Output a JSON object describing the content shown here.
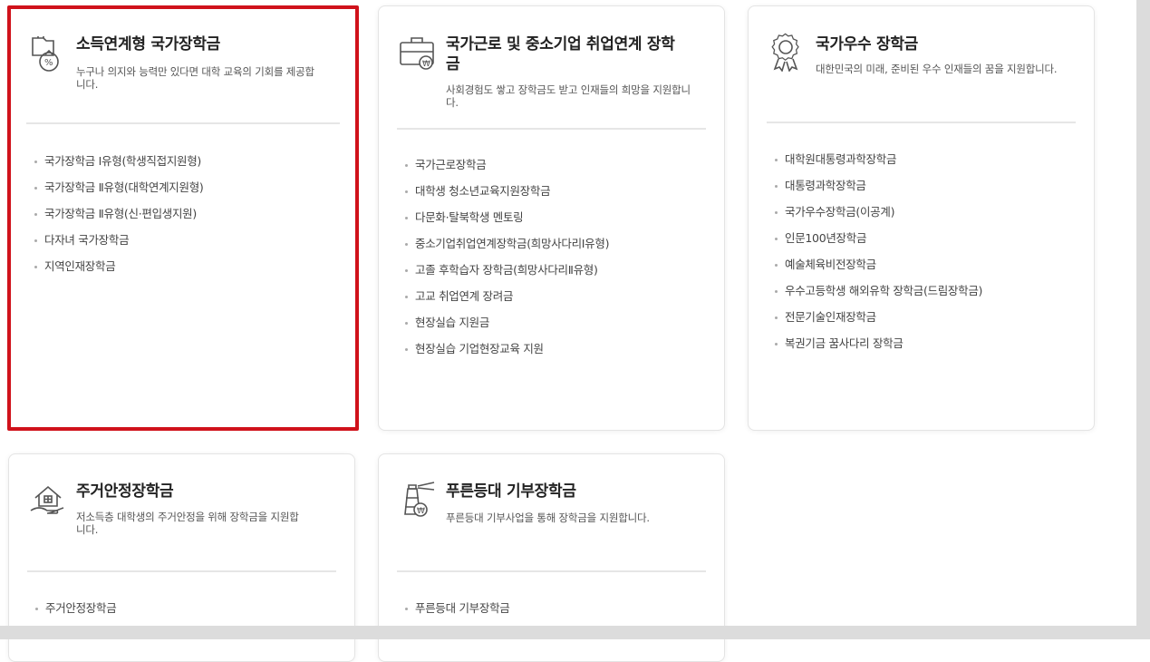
{
  "cards": [
    {
      "title": "소득연계형 국가장학금",
      "desc": "누구나 의지와 능력만 있다면 대학 교육의 기회를 제공합니다.",
      "icon": "money-bag-icon",
      "items": [
        "국가장학금 Ⅰ유형(학생직접지원형)",
        "국가장학금 Ⅱ유형(대학연계지원형)",
        "국가장학금 Ⅱ유형(신·편입생지원)",
        "다자녀 국가장학금",
        "지역인재장학금"
      ]
    },
    {
      "title": "국가근로 및 중소기업 취업연계 장학금",
      "desc": "사회경험도 쌓고 장학금도 받고 인재들의 희망을 지원합니다.",
      "icon": "briefcase-icon",
      "items": [
        "국가근로장학금",
        "대학생 청소년교육지원장학금",
        "다문화·탈북학생 멘토링",
        "중소기업취업연계장학금(희망사다리Ⅰ유형)",
        "고졸 후학습자 장학금(희망사다리Ⅱ유형)",
        "고교 취업연계 장려금",
        "현장실습 지원금",
        "현장실습 기업현장교육 지원"
      ]
    },
    {
      "title": "국가우수 장학금",
      "desc": "대한민국의 미래, 준비된 우수 인재들의 꿈을 지원합니다.",
      "icon": "award-medal-icon",
      "items": [
        "대학원대통령과학장학금",
        "대통령과학장학금",
        "국가우수장학금(이공계)",
        "인문100년장학금",
        "예술체육비전장학금",
        "우수고등학생 해외유학 장학금(드림장학금)",
        "전문기술인재장학금",
        "복권기금 꿈사다리 장학금"
      ]
    },
    {
      "title": "주거안정장학금",
      "desc": "저소득층 대학생의 주거안정을 위해 장학금을 지원합니다.",
      "icon": "house-hand-icon",
      "items": [
        "주거안정장학금"
      ]
    },
    {
      "title": "푸른등대 기부장학금",
      "desc": "푸른등대 기부사업을 통해 장학금을 지원합니다.",
      "icon": "lighthouse-icon",
      "items": [
        "푸른등대 기부장학금"
      ]
    }
  ],
  "colors": {
    "highlight": "#d0121b",
    "divider": "#e6e6e6",
    "title": "#222222"
  }
}
